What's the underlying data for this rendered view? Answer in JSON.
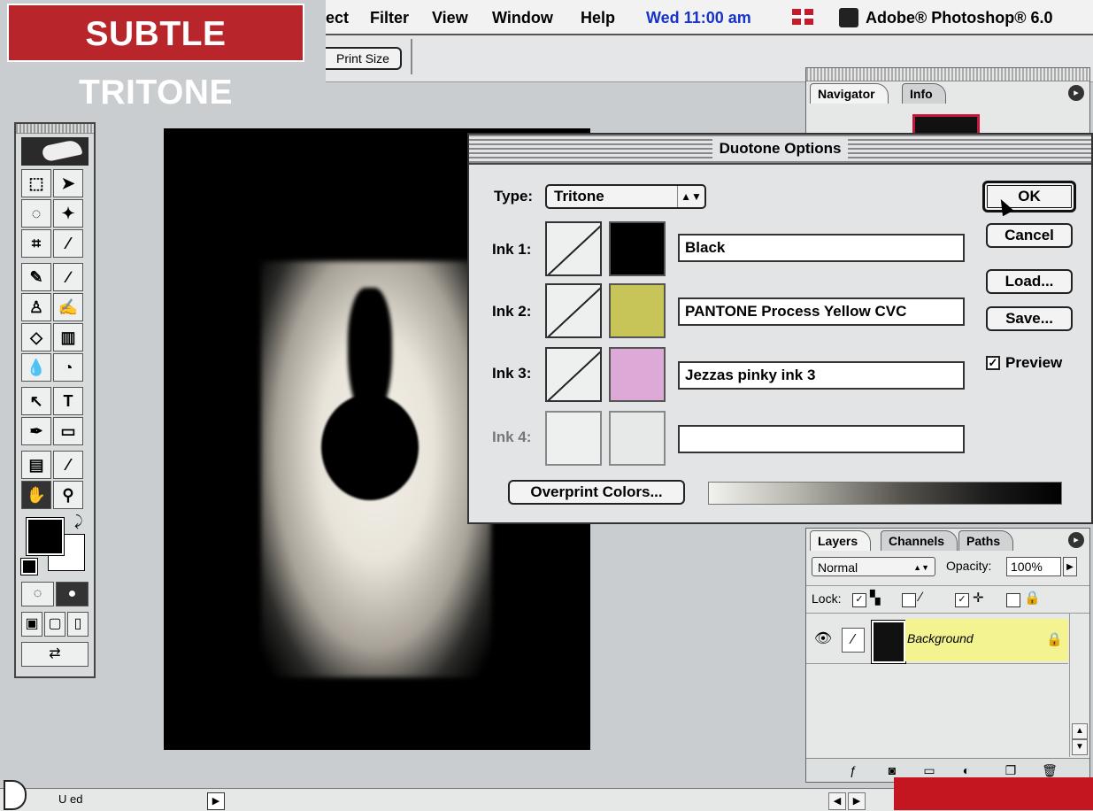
{
  "banner": {
    "title": "SUBTLE TRITONE"
  },
  "menubar": {
    "items": [
      "ect",
      "Filter",
      "View",
      "Window",
      "Help"
    ],
    "clock": "Wed 11:00 am",
    "app_name": "Adobe® Photoshop® 6.0"
  },
  "optionsbar": {
    "print_size": "Print Size"
  },
  "navigator": {
    "tabs": [
      "Navigator",
      "Info"
    ]
  },
  "dialog": {
    "title": "Duotone Options",
    "type_label": "Type:",
    "type_value": "Tritone",
    "inks": [
      {
        "label": "Ink 1:",
        "name": "Black",
        "color": "#000000"
      },
      {
        "label": "Ink 2:",
        "name": "PANTONE Process Yellow CVC",
        "color": "#c7c558"
      },
      {
        "label": "Ink 3:",
        "name": "Jezzas pinky ink 3",
        "color": "#ddaad8"
      },
      {
        "label": "Ink 4:",
        "name": "",
        "color": "#e6e9e8"
      }
    ],
    "buttons": {
      "ok": "OK",
      "cancel": "Cancel",
      "load": "Load...",
      "save": "Save..."
    },
    "preview_label": "Preview",
    "preview_checked": true,
    "overprint_button": "Overprint Colors..."
  },
  "layers": {
    "tabs": [
      "Layers",
      "Channels",
      "Paths"
    ],
    "blend_mode": "Normal",
    "opacity_label": "Opacity:",
    "opacity_value": "100%",
    "lock_label": "Lock:",
    "layer_name": "Background"
  },
  "statusbar": {
    "text": "U      ed"
  }
}
